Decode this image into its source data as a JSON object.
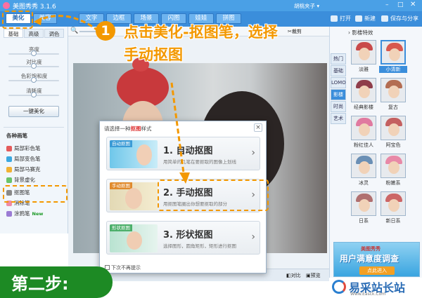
{
  "window": {
    "title": "美图秀秀 3.1.6",
    "user": "胡桃夹子 ▾"
  },
  "menu": {
    "tabs": [
      "美化",
      "美容",
      "文字",
      "边框",
      "场景",
      "闪图",
      "娃娃",
      "拼图"
    ],
    "actions": [
      "打开",
      "新建",
      "保存与分享"
    ]
  },
  "left_panel": {
    "tabs": [
      "基础",
      "高级",
      "调色"
    ],
    "sliders": [
      {
        "label": "亮度",
        "value": 0.5
      },
      {
        "label": "对比度",
        "value": 0.5
      },
      {
        "label": "色彩饱和度",
        "value": 0.5
      },
      {
        "label": "清晰度",
        "value": 0.5
      }
    ],
    "one_click": "一键美化",
    "pens_title": "各种画笔",
    "pens": [
      "局部彩色笔",
      "局部变色笔",
      "局部马赛克",
      "背景虚化",
      "抠图笔",
      "消除笔",
      "涂鸦笔"
    ],
    "new_badge": "New"
  },
  "canvas": {
    "crop_label": "裁剪",
    "compare_label": "对比",
    "preview_label": "预览"
  },
  "dialog": {
    "title": "请选择一种",
    "title_highlight": "抠图",
    "title_suffix": "样式",
    "close": "×",
    "options": [
      {
        "tag": "自动抠图",
        "name": "1. 自动抠图",
        "desc": "用简单的几笔在要抠取的图像上划线"
      },
      {
        "tag": "手动抠图",
        "name": "2. 手动抠图",
        "desc": "用抠图笔圈出你想要抠取的部分"
      },
      {
        "tag": "形状抠图",
        "name": "3. 形状抠图",
        "desc": "选择图形，圆角矩形，矩形进行抠图"
      }
    ],
    "checkbox_label": "下次不再提示"
  },
  "right_panel": {
    "header": "影楼特效",
    "tabs": [
      "热门",
      "LOMO",
      "影楼",
      "时尚",
      "艺术",
      "基础"
    ],
    "thumbs": [
      {
        "label": "淡雅",
        "hat": "#c94a4a"
      },
      {
        "label": "小清新",
        "hat": "#d8584e"
      },
      {
        "label": "经典影楼",
        "hat": "#8f3d4a"
      },
      {
        "label": "复古",
        "hat": "#b36d52"
      },
      {
        "label": "粉红佳人",
        "hat": "#e07aa0"
      },
      {
        "label": "阿宝色",
        "hat": "#c46060"
      },
      {
        "label": "冰灵",
        "hat": "#6a8fb5"
      },
      {
        "label": "粉嫩系",
        "hat": "#e889a7"
      },
      {
        "label": "日系",
        "hat": "#b07070"
      },
      {
        "label": "新日系",
        "hat": "#cc6666"
      }
    ],
    "ad_line1": "美图秀秀",
    "ad_line2": "用户满意度调查",
    "ad_button": "点此进入"
  },
  "annotation": {
    "step_number": "1",
    "line1": "点击美化-抠图笔，选择",
    "line2": "手动抠图",
    "step_badge": "第二步:"
  },
  "watermark": {
    "text": "易采站长站",
    "sub": "Www.Easck.Com"
  },
  "colors": {
    "accent": "#f39800",
    "brand": "#3b8edb",
    "badge": "#1d8a24"
  }
}
